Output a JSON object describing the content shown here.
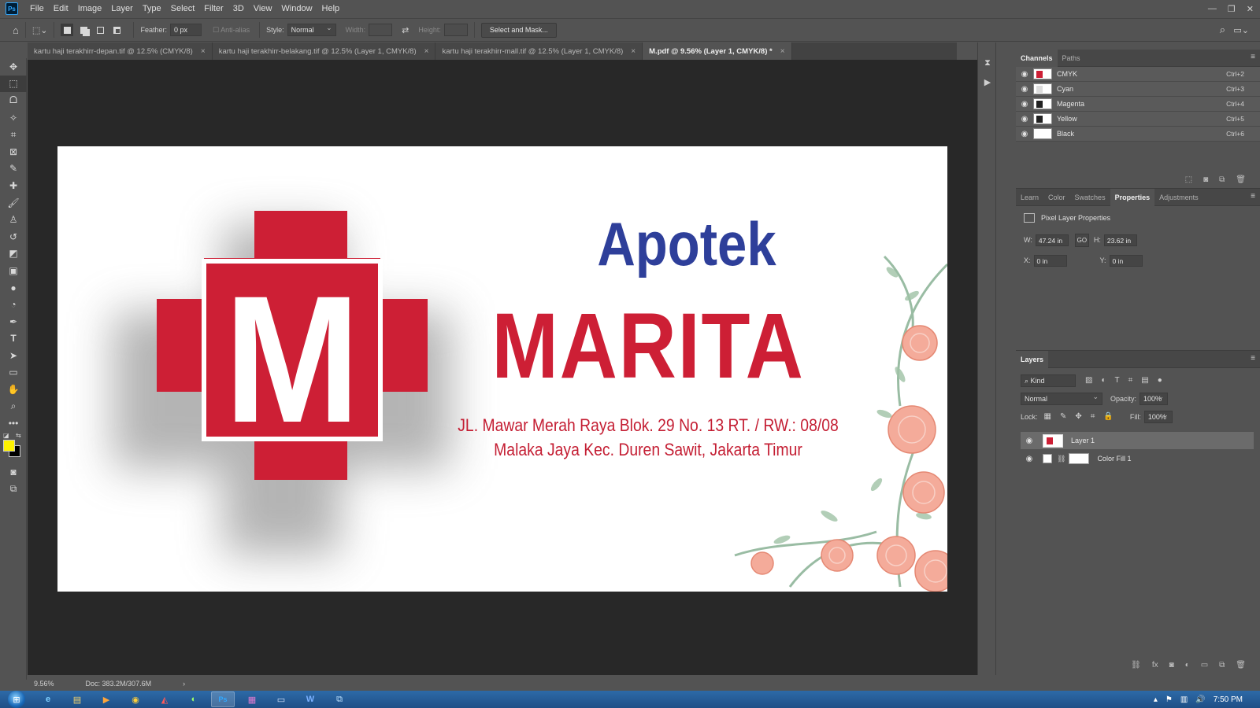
{
  "app": {
    "logo_text": "Ps",
    "menu": [
      "File",
      "Edit",
      "Image",
      "Layer",
      "Type",
      "Select",
      "Filter",
      "3D",
      "View",
      "Window",
      "Help"
    ]
  },
  "options": {
    "feather_label": "Feather:",
    "feather_value": "0 px",
    "antialias_label": "Anti-alias",
    "style_label": "Style:",
    "style_value": "Normal",
    "width_label": "Width:",
    "height_label": "Height:",
    "select_mask_label": "Select and Mask..."
  },
  "tabs": [
    {
      "label": "kartu haji terakhirr-depan.tif @ 12.5% (CMYK/8)"
    },
    {
      "label": "kartu haji terakhirr-belakang.tif @ 12.5% (Layer 1, CMYK/8)"
    },
    {
      "label": "kartu haji terakhirr-mall.tif @ 12.5% (Layer 1, CMYK/8)"
    },
    {
      "label": "M.pdf @ 9.56% (Layer 1, CMYK/8) *"
    }
  ],
  "tab_close": "×",
  "artwork": {
    "logo_letter": "M",
    "apotek": "Apotek",
    "name": "MARITA",
    "address_line1": "JL. Mawar Merah Raya Blok. 29 No. 13 RT. / RW.: 08/08",
    "address_line2": "Malaka Jaya Kec. Duren Sawit, Jakarta Timur",
    "colors": {
      "red": "#cd1f35",
      "blue": "#2e3f9a"
    }
  },
  "status": {
    "zoom": "9.56%",
    "doc": "Doc: 383.2M/307.6M",
    "arrow": "›"
  },
  "channels": {
    "tabs": [
      "Channels",
      "Paths"
    ],
    "rows": [
      {
        "name": "CMYK",
        "shortcut": "Ctrl+2"
      },
      {
        "name": "Cyan",
        "shortcut": "Ctrl+3"
      },
      {
        "name": "Magenta",
        "shortcut": "Ctrl+4"
      },
      {
        "name": "Yellow",
        "shortcut": "Ctrl+5"
      },
      {
        "name": "Black",
        "shortcut": "Ctrl+6"
      }
    ]
  },
  "properties": {
    "tabs": [
      "Learn",
      "Color",
      "Swatches",
      "Properties",
      "Adjustments"
    ],
    "title": "Pixel Layer Properties",
    "w_label": "W:",
    "w_value": "47.24 in",
    "link_label": "GO",
    "h_label": "H:",
    "h_value": "23.62 in",
    "x_label": "X:",
    "x_value": "0 in",
    "y_label": "Y:",
    "y_value": "0 in"
  },
  "layers": {
    "title": "Layers",
    "kind": "Kind",
    "blend_mode": "Normal",
    "opacity_label": "Opacity:",
    "opacity_value": "100%",
    "lock_label": "Lock:",
    "fill_label": "Fill:",
    "fill_value": "100%",
    "items": [
      {
        "name": "Layer 1"
      },
      {
        "name": "Color Fill 1"
      }
    ]
  },
  "taskbar": {
    "time": "7:50 PM"
  },
  "swatches": {
    "foreground": "#fff200",
    "background": "#000000"
  }
}
